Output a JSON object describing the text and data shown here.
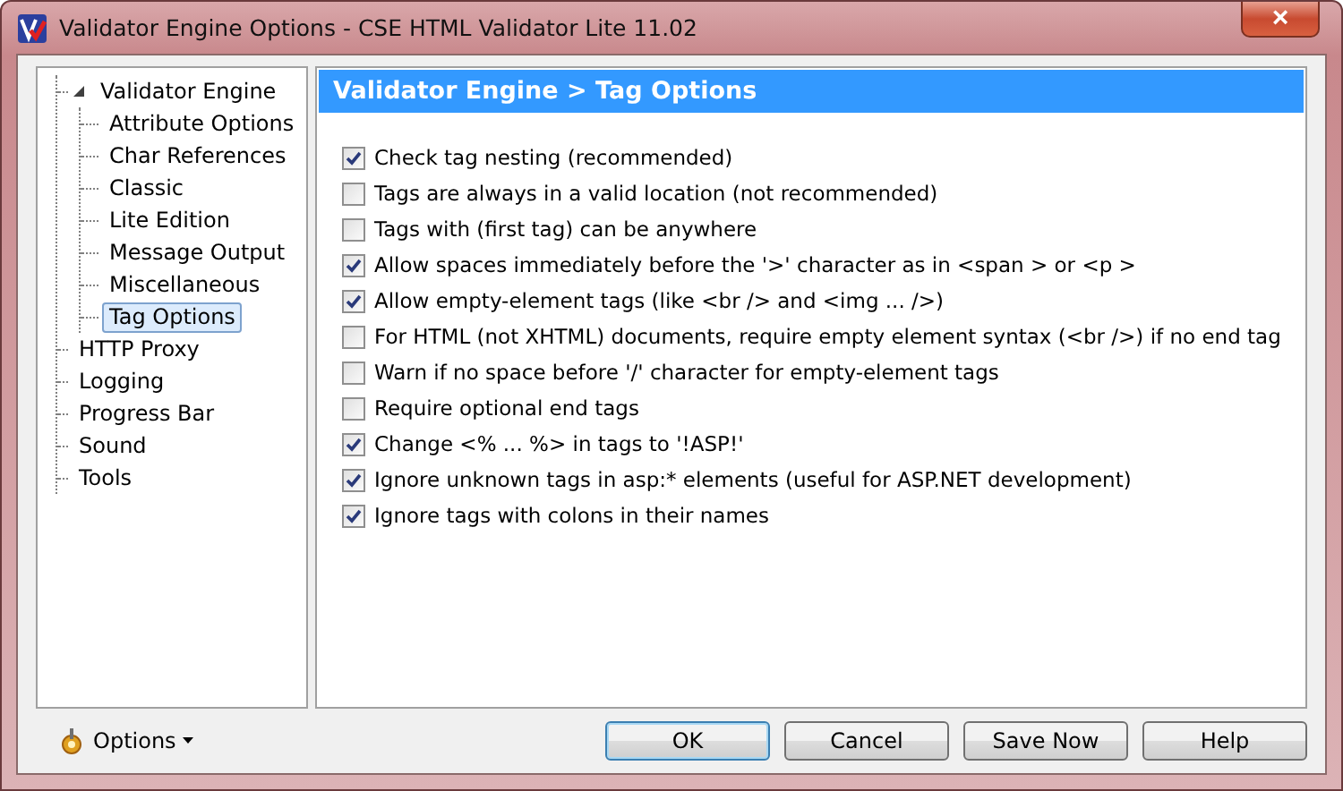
{
  "window": {
    "title": "Validator Engine Options - CSE HTML Validator Lite 11.02",
    "close": "×"
  },
  "tree": [
    {
      "label": "Validator Engine",
      "expanded": true,
      "selected": false,
      "children": [
        {
          "label": "Attribute Options",
          "selected": false
        },
        {
          "label": "Char References",
          "selected": false
        },
        {
          "label": "Classic",
          "selected": false
        },
        {
          "label": "Lite Edition",
          "selected": false
        },
        {
          "label": "Message Output",
          "selected": false
        },
        {
          "label": "Miscellaneous",
          "selected": false
        },
        {
          "label": "Tag Options",
          "selected": true
        }
      ]
    },
    {
      "label": "HTTP Proxy",
      "selected": false
    },
    {
      "label": "Logging",
      "selected": false
    },
    {
      "label": "Progress Bar",
      "selected": false
    },
    {
      "label": "Sound",
      "selected": false
    },
    {
      "label": "Tools",
      "selected": false
    }
  ],
  "panel": {
    "title": "Validator Engine > Tag Options",
    "options": [
      {
        "label": "Check tag nesting (recommended)",
        "checked": true
      },
      {
        "label": "Tags are always in a valid location (not recommended)",
        "checked": false
      },
      {
        "label": "Tags with (first tag) can be anywhere",
        "checked": false
      },
      {
        "label": "Allow spaces immediately before the '>' character as in <span > or <p >",
        "checked": true
      },
      {
        "label": "Allow empty-element tags (like <br /> and <img ... />)",
        "checked": true
      },
      {
        "label": "For HTML (not XHTML) documents, require empty element syntax (<br />) if no end tag",
        "checked": false
      },
      {
        "label": "Warn if no space before '/' character for empty-element tags",
        "checked": false
      },
      {
        "label": "Require optional end tags",
        "checked": false
      },
      {
        "label": "Change <% ... %> in tags to '!ASP!'",
        "checked": true
      },
      {
        "label": "Ignore unknown tags in asp:* elements (useful for ASP.NET development)",
        "checked": true
      },
      {
        "label": "Ignore tags with colons in their names",
        "checked": true
      }
    ]
  },
  "options_menu": {
    "label": "Options"
  },
  "buttons": [
    {
      "label": "OK",
      "default": true
    },
    {
      "label": "Cancel",
      "default": false
    },
    {
      "label": "Save Now",
      "default": false
    },
    {
      "label": "Help",
      "default": false
    }
  ]
}
